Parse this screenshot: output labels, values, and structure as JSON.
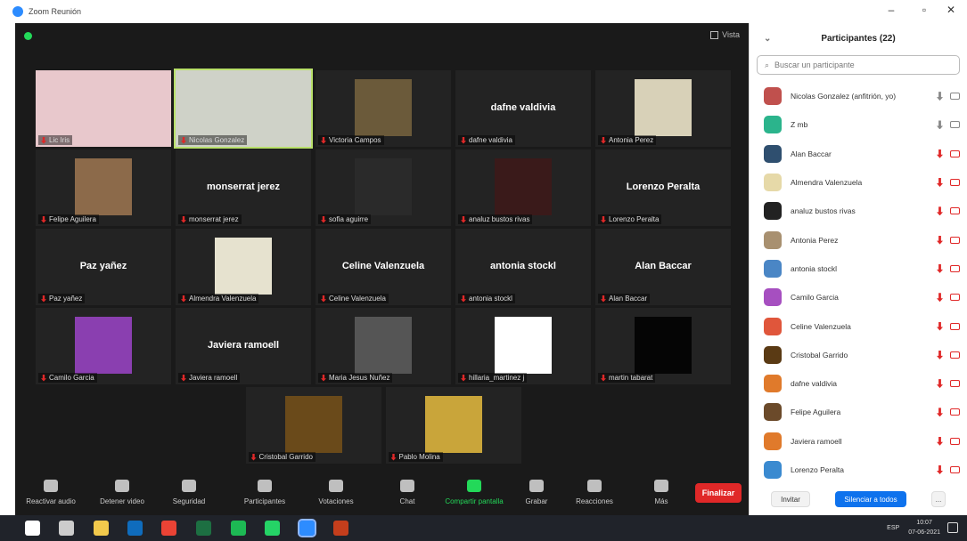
{
  "window": {
    "title": "Zoom Reunión"
  },
  "meeting": {
    "view_label": "Vista"
  },
  "tiles": [
    {
      "row": 0,
      "col": 0,
      "name": "Lic Iris",
      "kind": "video",
      "bg": "#e8c8cc",
      "active": false
    },
    {
      "row": 0,
      "col": 1,
      "name": "Nicolas Gonzalez",
      "kind": "video",
      "bg": "#cfd2c8",
      "active": true
    },
    {
      "row": 0,
      "col": 2,
      "name": "Victoria Campos",
      "kind": "thumb",
      "bg": "#6b5a3a",
      "active": false
    },
    {
      "row": 0,
      "col": 3,
      "name": "dafne valdivia",
      "kind": "name",
      "big": "dafne valdivia",
      "active": false
    },
    {
      "row": 0,
      "col": 4,
      "name": "Antonia Perez",
      "kind": "thumb",
      "bg": "#d8d1b8",
      "active": false
    },
    {
      "row": 1,
      "col": 0,
      "name": "Felipe Aguilera",
      "kind": "thumb",
      "bg": "#8c6a4a",
      "active": false
    },
    {
      "row": 1,
      "col": 1,
      "name": "monserrat jerez",
      "kind": "name",
      "big": "monserrat jerez",
      "active": false
    },
    {
      "row": 1,
      "col": 2,
      "name": "sofia aguirre",
      "kind": "thumb",
      "bg": "#2a2a2a",
      "active": false
    },
    {
      "row": 1,
      "col": 3,
      "name": "analuz bustos rivas",
      "kind": "thumb",
      "bg": "#3a1a1a",
      "active": false
    },
    {
      "row": 1,
      "col": 4,
      "name": "Lorenzo Peralta",
      "kind": "name",
      "big": "Lorenzo Peralta",
      "active": false
    },
    {
      "row": 2,
      "col": 0,
      "name": "Paz yañez",
      "kind": "name",
      "big": "Paz yañez",
      "active": false
    },
    {
      "row": 2,
      "col": 1,
      "name": "Almendra Valenzuela",
      "kind": "thumb",
      "bg": "#e6e2cf",
      "active": false
    },
    {
      "row": 2,
      "col": 2,
      "name": "Celine Valenzuela",
      "kind": "name",
      "big": "Celine Valenzuela",
      "active": false
    },
    {
      "row": 2,
      "col": 3,
      "name": "antonia stockl",
      "kind": "name",
      "big": "antonia stockl",
      "active": false
    },
    {
      "row": 2,
      "col": 4,
      "name": "Alan Baccar",
      "kind": "name",
      "big": "Alan Baccar",
      "active": false
    },
    {
      "row": 3,
      "col": 0,
      "name": "Camilo Garcia",
      "kind": "thumb",
      "bg": "#8a3fb0",
      "active": false
    },
    {
      "row": 3,
      "col": 1,
      "name": "Javiera ramoell",
      "kind": "name",
      "big": "Javiera ramoell",
      "active": false
    },
    {
      "row": 3,
      "col": 2,
      "name": "Maria Jesus Nuñez",
      "kind": "thumb",
      "bg": "#555555",
      "active": false
    },
    {
      "row": 3,
      "col": 3,
      "name": "hillaria_martinez j",
      "kind": "thumb",
      "bg": "#ffffff",
      "active": false
    },
    {
      "row": 3,
      "col": 4,
      "name": "martin tabarat",
      "kind": "thumb",
      "bg": "#050505",
      "active": false
    },
    {
      "row": 4,
      "col": 1.5,
      "name": "Cristobal Garrido",
      "kind": "thumb",
      "bg": "#6a4a1a",
      "active": false
    },
    {
      "row": 4,
      "col": 2.5,
      "name": "Pablo Molina",
      "kind": "thumb",
      "bg": "#c9a53a",
      "active": false
    }
  ],
  "toolbar": {
    "items": [
      {
        "label": "Reactivar audio",
        "name": "unmute-button",
        "icon": "microphone-icon"
      },
      {
        "label": "Detener video",
        "name": "stop-video-button",
        "icon": "video-camera-icon"
      },
      {
        "label": "Seguridad",
        "name": "security-button",
        "icon": "shield-icon"
      },
      {
        "label": "Participantes",
        "name": "participants-button",
        "icon": "people-icon"
      },
      {
        "label": "Votaciones",
        "name": "polls-button",
        "icon": "bar-chart-icon"
      },
      {
        "label": "Chat",
        "name": "chat-button",
        "icon": "chat-bubble-icon"
      },
      {
        "label": "Compartir pantalla",
        "name": "share-screen-button",
        "icon": "share-screen-icon"
      },
      {
        "label": "Grabar",
        "name": "record-button",
        "icon": "record-icon"
      },
      {
        "label": "Reacciones",
        "name": "reactions-button",
        "icon": "smiley-icon"
      },
      {
        "label": "Más",
        "name": "more-button",
        "icon": "ellipsis-icon"
      }
    ],
    "end_label": "Finalizar"
  },
  "panel": {
    "title": "Participantes (22)",
    "search_placeholder": "Buscar un participante",
    "participants": [
      {
        "name": "Nicolas Gonzalez (anfitrión, yo)",
        "color": "#c0504d",
        "muted": false,
        "cam_on": true
      },
      {
        "name": "Z mb",
        "color": "#2bb48c",
        "muted": false,
        "cam_on": true
      },
      {
        "name": "Alan Baccar",
        "color": "#2f4f6f",
        "muted": true,
        "cam_on": false
      },
      {
        "name": "Almendra Valenzuela",
        "color": "#e6d9a8",
        "muted": true,
        "cam_on": false
      },
      {
        "name": "analuz bustos rivas",
        "color": "#222222",
        "muted": true,
        "cam_on": false
      },
      {
        "name": "Antonia Perez",
        "color": "#a89070",
        "muted": true,
        "cam_on": false
      },
      {
        "name": "antonia stockl",
        "color": "#4a86c5",
        "muted": true,
        "cam_on": false
      },
      {
        "name": "Camilo Garcia",
        "color": "#a64fc0",
        "muted": true,
        "cam_on": false
      },
      {
        "name": "Celine Valenzuela",
        "color": "#e0563b",
        "muted": true,
        "cam_on": false
      },
      {
        "name": "Cristobal Garrido",
        "color": "#5a3a14",
        "muted": true,
        "cam_on": false
      },
      {
        "name": "dafne valdivia",
        "color": "#e07a2b",
        "muted": true,
        "cam_on": false
      },
      {
        "name": "Felipe Aguilera",
        "color": "#6b4a2a",
        "muted": true,
        "cam_on": false
      },
      {
        "name": "Javiera ramoell",
        "color": "#e07a2b",
        "muted": true,
        "cam_on": false
      },
      {
        "name": "Lorenzo Peralta",
        "color": "#3a8ad0",
        "muted": true,
        "cam_on": false
      }
    ],
    "invite_label": "Invitar",
    "mute_all_label": "Silenciar a todos",
    "more_label": "..."
  },
  "taskbar": {
    "lang": "ESP",
    "time": "10:07",
    "date": "07-06-2021",
    "apps": [
      "windows-start-icon",
      "search-icon",
      "file-explorer-icon",
      "outlook-icon",
      "chrome-icon",
      "excel-icon",
      "spotify-icon",
      "whatsapp-icon",
      "zoom-icon",
      "powerpoint-icon"
    ]
  }
}
